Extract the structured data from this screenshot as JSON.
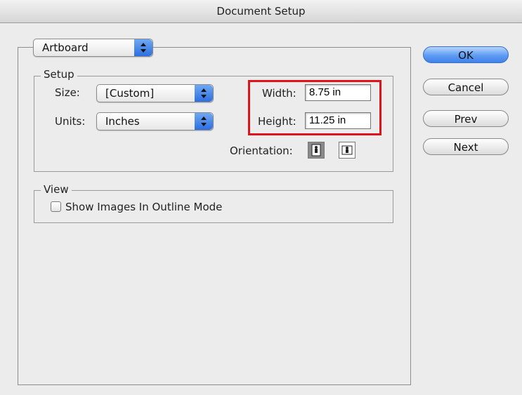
{
  "window": {
    "title": "Document Setup"
  },
  "category_popup": {
    "value": "Artboard"
  },
  "setup": {
    "legend": "Setup",
    "size_label": "Size:",
    "size_value": "[Custom]",
    "units_label": "Units:",
    "units_value": "Inches",
    "width_label": "Width:",
    "width_value": "8.75 in",
    "height_label": "Height:",
    "height_value": "11.25 in",
    "orientation_label": "Orientation:",
    "orientation_selected": "portrait"
  },
  "view": {
    "legend": "View",
    "show_images_label": "Show Images In Outline Mode",
    "show_images_checked": false
  },
  "buttons": {
    "ok": "OK",
    "cancel": "Cancel",
    "prev": "Prev",
    "next": "Next"
  },
  "colors": {
    "highlight": "#e0131b",
    "accent": "#3f82ea"
  },
  "icons": {
    "portrait": "portrait-orientation-icon",
    "landscape": "landscape-orientation-icon"
  }
}
